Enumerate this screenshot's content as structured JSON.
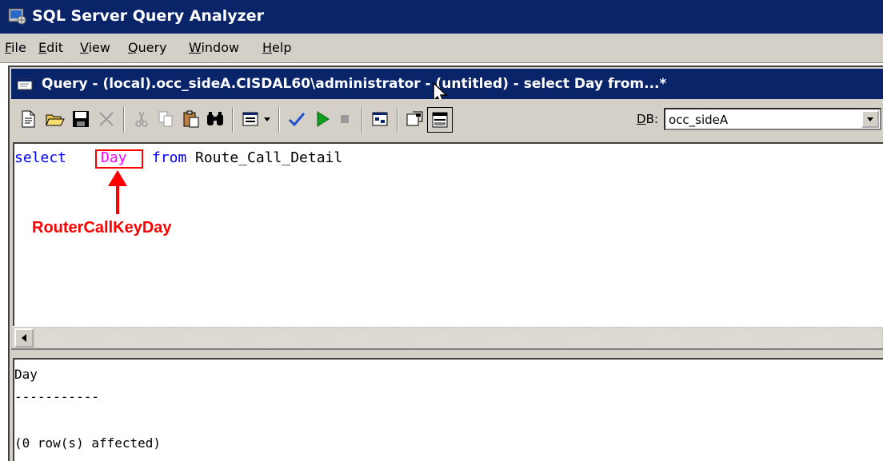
{
  "app": {
    "title": "SQL Server Query Analyzer",
    "title_bar_color": "#0a246a"
  },
  "menu": {
    "items": [
      {
        "u": "F",
        "rest": "ile"
      },
      {
        "u": "E",
        "rest": "dit"
      },
      {
        "u": "V",
        "rest": "iew"
      },
      {
        "u": "Q",
        "rest": "uery"
      },
      {
        "u": "W",
        "rest": "indow"
      },
      {
        "u": "H",
        "rest": "elp"
      }
    ]
  },
  "query_window": {
    "title": "Query - (local).occ_sideA.CISDAL60\\administrator - (untitled) - select Day from...*"
  },
  "toolbar": {
    "icons": [
      "new-query-icon",
      "open-file-icon",
      "save-icon",
      "clear-icon",
      "cut-icon",
      "copy-icon",
      "paste-icon",
      "find-icon",
      "results-mode-icon",
      "dropdown-arrow-icon",
      "parse-icon",
      "execute-icon",
      "cancel-icon",
      "execution-plan-icon",
      "object-browser-icon",
      "object-search-icon"
    ],
    "db_label_u": "D",
    "db_label_rest": "B:",
    "db_value": "occ_sideA"
  },
  "editor": {
    "kw_select": "select",
    "column": "Day",
    "kw_from": "from",
    "table": "Route_Call_Detail",
    "annotation": "RouterCallKeyDay",
    "colors": {
      "keyword": "#0000ff",
      "column": "#ff00ff",
      "annotation": "#ff0000"
    }
  },
  "results": {
    "header": "Day",
    "rule": "-----------",
    "message": "(0 row(s) affected)"
  }
}
